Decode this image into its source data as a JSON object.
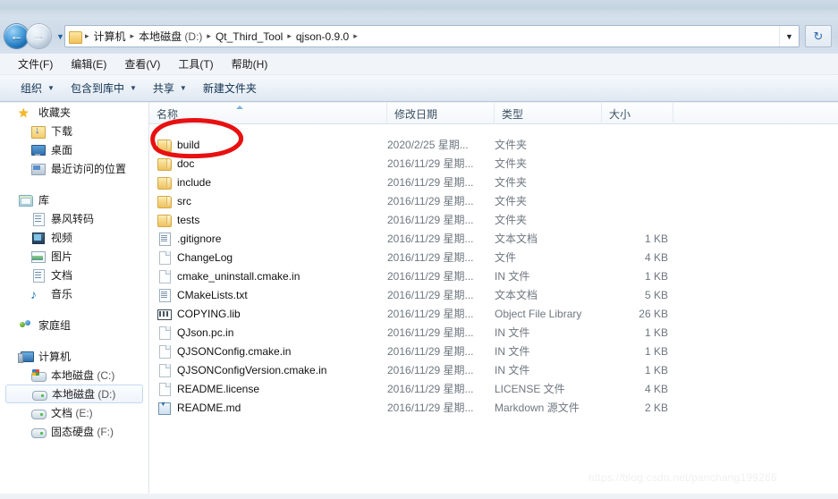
{
  "window": {
    "titlebar_color": "#ccd9e6"
  },
  "address_bar": {
    "back_button": "←",
    "forward_button": "→",
    "history_dropdown": "▼",
    "folder_icon": "folder-icon",
    "breadcrumbs": [
      {
        "label": "计算机"
      },
      {
        "label": "本地磁盘",
        "suffix": " (D:)"
      },
      {
        "label": "Qt_Third_Tool"
      },
      {
        "label": "qjson-0.9.0"
      }
    ],
    "separator": "▸",
    "dropdown_chevron": "▼",
    "refresh_label": "↻"
  },
  "menu_bar": {
    "items": [
      {
        "label": "文件(F)"
      },
      {
        "label": "编辑(E)"
      },
      {
        "label": "查看(V)"
      },
      {
        "label": "工具(T)"
      },
      {
        "label": "帮助(H)"
      }
    ]
  },
  "toolbar": {
    "items": [
      {
        "label": "组织",
        "caret": "▼"
      },
      {
        "label": "包含到库中",
        "caret": "▼"
      },
      {
        "label": "共享",
        "caret": "▼"
      },
      {
        "label": "新建文件夹",
        "caret": ""
      }
    ]
  },
  "nav_pane": {
    "groups": [
      {
        "header": {
          "label": "收藏夹",
          "icon": "star-icon"
        },
        "items": [
          {
            "label": "下载",
            "icon": "downloads-icon"
          },
          {
            "label": "桌面",
            "icon": "desktop-icon"
          },
          {
            "label": "最近访问的位置",
            "icon": "recent-places-icon"
          }
        ]
      },
      {
        "header": {
          "label": "库",
          "icon": "library-icon"
        },
        "items": [
          {
            "label": "暴风转码",
            "icon": "baofeng-icon"
          },
          {
            "label": "视频",
            "icon": "videos-icon"
          },
          {
            "label": "图片",
            "icon": "pictures-icon"
          },
          {
            "label": "文档",
            "icon": "documents-icon"
          },
          {
            "label": "音乐",
            "icon": "music-icon"
          }
        ]
      },
      {
        "header": {
          "label": "家庭组",
          "icon": "homegroup-icon"
        },
        "items": []
      },
      {
        "header": {
          "label": "计算机",
          "icon": "computer-icon"
        },
        "items": [
          {
            "label": "本地磁盘",
            "suffix": " (C:)",
            "icon": "drive-c-icon",
            "selected": false
          },
          {
            "label": "本地磁盘",
            "suffix": " (D:)",
            "icon": "drive-icon",
            "selected": true
          },
          {
            "label": "文档",
            "suffix": " (E:)",
            "icon": "drive-icon",
            "selected": false
          },
          {
            "label": "固态硬盘",
            "suffix": " (F:)",
            "icon": "drive-icon",
            "selected": false
          }
        ]
      }
    ]
  },
  "file_list": {
    "columns": [
      {
        "label": "名称",
        "key": "name"
      },
      {
        "label": "修改日期",
        "key": "date"
      },
      {
        "label": "类型",
        "key": "type"
      },
      {
        "label": "大小",
        "key": "size"
      }
    ],
    "sort_column": "名称",
    "sort_direction": "ascending",
    "rows": [
      {
        "name": "build",
        "date": "2020/2/25 星期...",
        "type": "文件夹",
        "size": "",
        "icon": "folder-icon"
      },
      {
        "name": "doc",
        "date": "2016/11/29 星期...",
        "type": "文件夹",
        "size": "",
        "icon": "folder-icon"
      },
      {
        "name": "include",
        "date": "2016/11/29 星期...",
        "type": "文件夹",
        "size": "",
        "icon": "folder-icon"
      },
      {
        "name": "src",
        "date": "2016/11/29 星期...",
        "type": "文件夹",
        "size": "",
        "icon": "folder-icon"
      },
      {
        "name": "tests",
        "date": "2016/11/29 星期...",
        "type": "文件夹",
        "size": "",
        "icon": "folder-icon"
      },
      {
        "name": ".gitignore",
        "date": "2016/11/29 星期...",
        "type": "文本文档",
        "size": "1 KB",
        "icon": "text-file-icon"
      },
      {
        "name": "ChangeLog",
        "date": "2016/11/29 星期...",
        "type": "文件",
        "size": "4 KB",
        "icon": "generic-file-icon"
      },
      {
        "name": "cmake_uninstall.cmake.in",
        "date": "2016/11/29 星期...",
        "type": "IN 文件",
        "size": "1 KB",
        "icon": "generic-file-icon"
      },
      {
        "name": "CMakeLists.txt",
        "date": "2016/11/29 星期...",
        "type": "文本文档",
        "size": "5 KB",
        "icon": "text-file-icon"
      },
      {
        "name": "COPYING.lib",
        "date": "2016/11/29 星期...",
        "type": "Object File Library",
        "size": "26 KB",
        "icon": "library-file-icon"
      },
      {
        "name": "QJson.pc.in",
        "date": "2016/11/29 星期...",
        "type": "IN 文件",
        "size": "1 KB",
        "icon": "generic-file-icon"
      },
      {
        "name": "QJSONConfig.cmake.in",
        "date": "2016/11/29 星期...",
        "type": "IN 文件",
        "size": "1 KB",
        "icon": "generic-file-icon"
      },
      {
        "name": "QJSONConfigVersion.cmake.in",
        "date": "2016/11/29 星期...",
        "type": "IN 文件",
        "size": "1 KB",
        "icon": "generic-file-icon"
      },
      {
        "name": "README.license",
        "date": "2016/11/29 星期...",
        "type": "LICENSE 文件",
        "size": "4 KB",
        "icon": "generic-file-icon"
      },
      {
        "name": "README.md",
        "date": "2016/11/29 星期...",
        "type": "Markdown 源文件",
        "size": "2 KB",
        "icon": "markdown-file-icon"
      }
    ]
  },
  "annotation": {
    "shape": "hand-drawn-ellipse",
    "color": "#e81010",
    "target": "build"
  },
  "watermark": {
    "text": "https://blog.csdn.net/panchang199266"
  }
}
